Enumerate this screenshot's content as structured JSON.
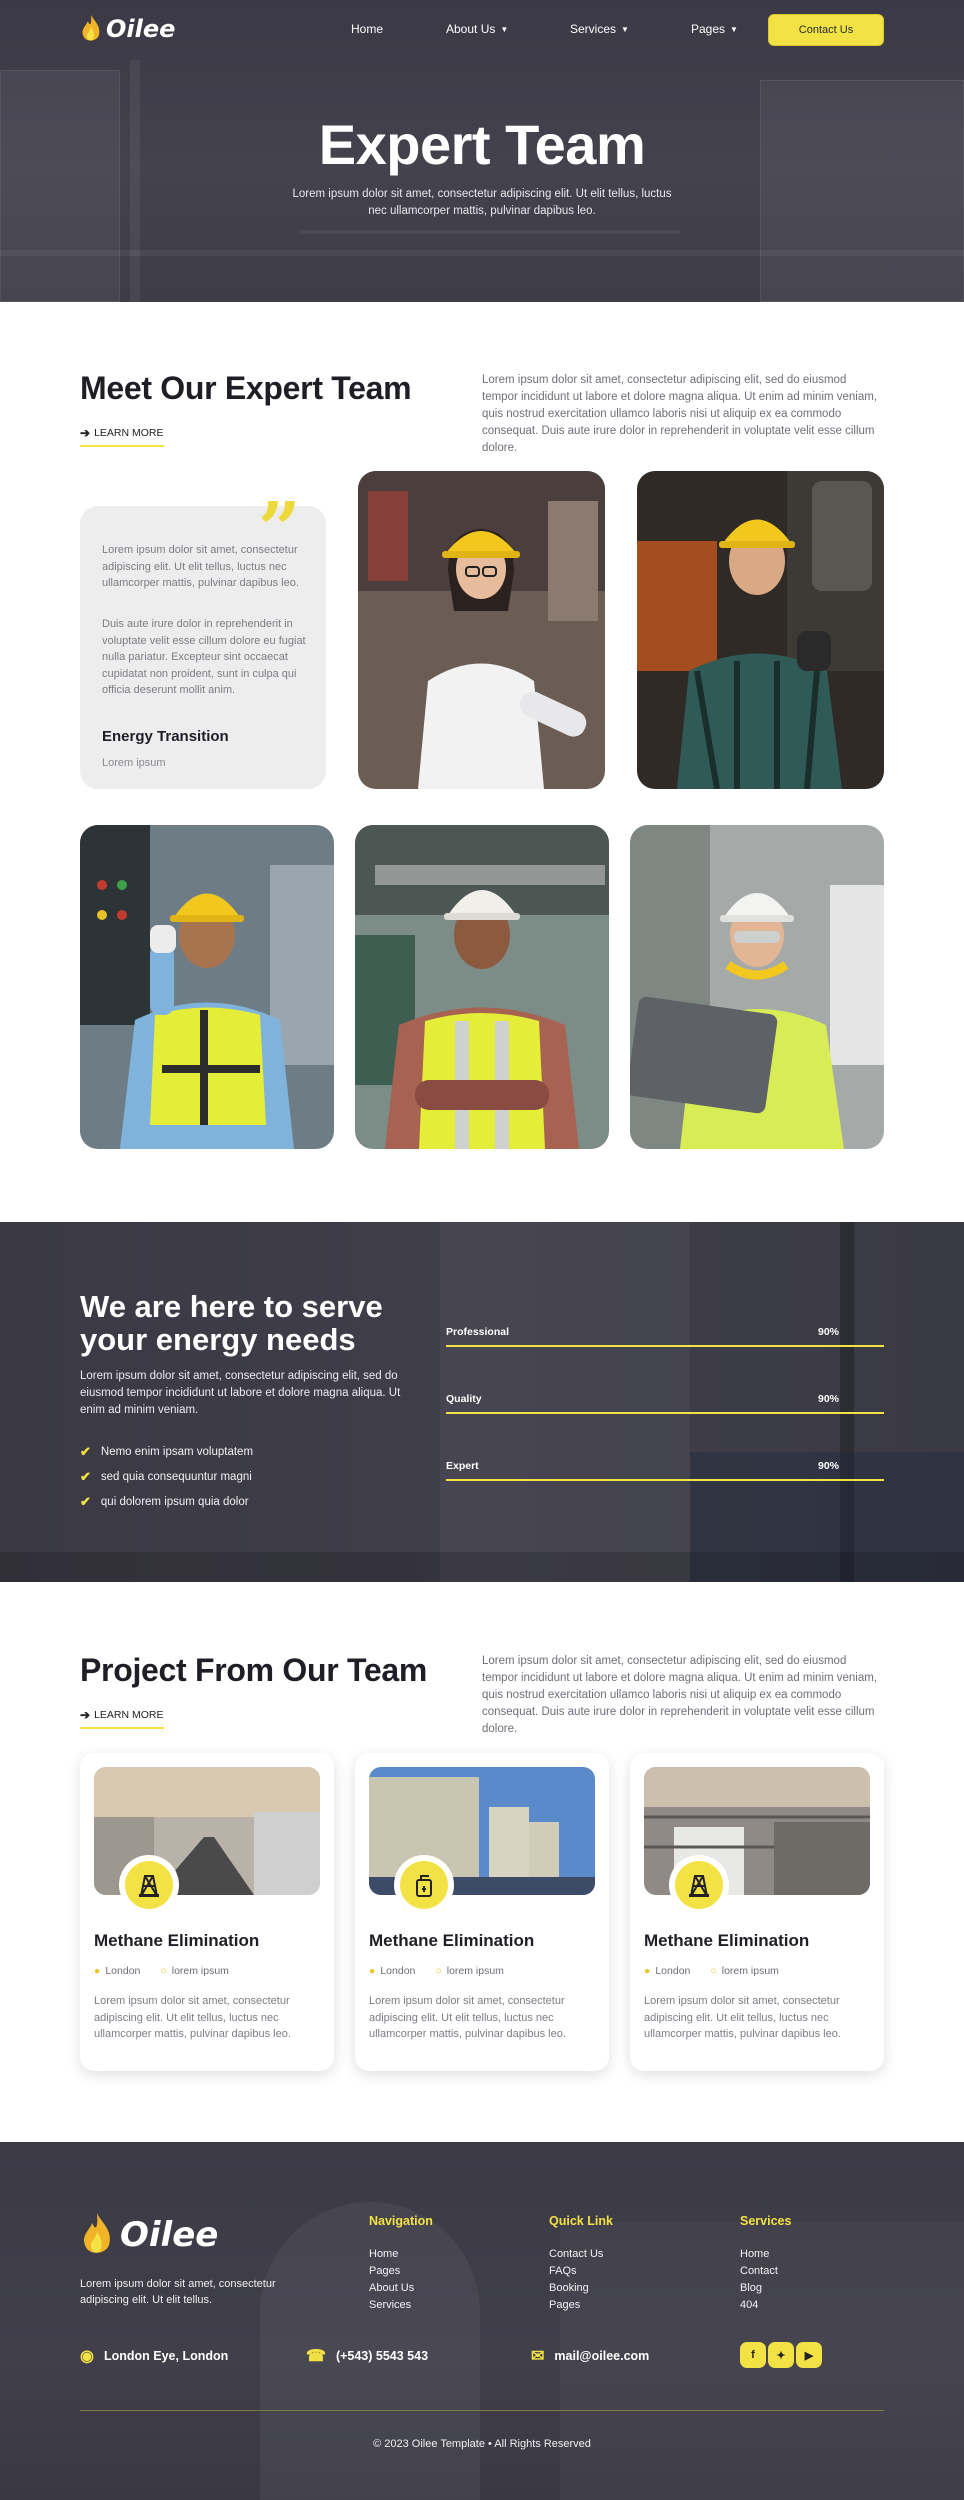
{
  "colors": {
    "accent": "#f3e244",
    "dark": "#3e3d48",
    "text_muted": "#6e6e78"
  },
  "nav": {
    "logo": "Oilee",
    "items": [
      {
        "label": "Home",
        "dropdown": false
      },
      {
        "label": "About Us",
        "dropdown": true
      },
      {
        "label": "Services",
        "dropdown": true
      },
      {
        "label": "Pages",
        "dropdown": true
      }
    ],
    "contact_label": "Contact Us"
  },
  "hero": {
    "title": "Expert Team",
    "subtitle": "Lorem ipsum dolor sit amet, consectetur adipiscing elit. Ut elit tellus, luctus nec ullamcorper mattis, pulvinar dapibus leo."
  },
  "team": {
    "title": "Meet Our Expert Team",
    "paragraph": "Lorem ipsum dolor sit amet, consectetur adipiscing elit, sed do eiusmod tempor incididunt ut labore et dolore magna aliqua. Ut enim ad minim veniam, quis nostrud exercitation ullamco laboris nisi ut aliquip ex ea commodo consequat. Duis aute irure dolor in reprehenderit in voluptate velit esse cillum dolore.",
    "learn_more": "LEARN MORE",
    "quote": {
      "p1": "Lorem ipsum dolor sit amet, consectetur adipiscing elit. Ut elit tellus, luctus nec ullamcorper mattis, pulvinar dapibus leo.",
      "p2": "Duis aute irure dolor in reprehenderit in voluptate velit esse cillum dolore eu fugiat nulla pariatur. Excepteur sint occaecat cupidatat non proident, sunt in culpa qui officia deserunt mollit anim.",
      "name": "Energy Transition",
      "role": "Lorem ipsum"
    }
  },
  "serve": {
    "title": "We are here to serve your energy needs",
    "paragraph": "Lorem ipsum dolor sit amet, consectetur adipiscing elit, sed do eiusmod tempor incididunt ut labore et dolore magna aliqua. Ut enim ad minim veniam.",
    "checklist": [
      "Nemo enim ipsam voluptatem",
      "sed quia consequuntur magni",
      "qui dolorem ipsum quia dolor"
    ],
    "skills": [
      {
        "label": "Professional",
        "value": "90%",
        "fraction": 0.9
      },
      {
        "label": "Quality",
        "value": "90%",
        "fraction": 0.9
      },
      {
        "label": "Expert",
        "value": "90%",
        "fraction": 0.9
      }
    ]
  },
  "projects": {
    "title": "Project From Our Team",
    "paragraph": "Lorem ipsum dolor sit amet, consectetur adipiscing elit, sed do eiusmod tempor incididunt ut labore et dolore magna aliqua. Ut enim ad minim veniam, quis nostrud exercitation ullamco laboris nisi ut aliquip ex ea commodo consequat. Duis aute irure dolor in reprehenderit in voluptate velit esse cillum dolore.",
    "learn_more": "LEARN MORE",
    "cards": [
      {
        "title": "Methane Elimination",
        "location": "London",
        "tag": "lorem ipsum",
        "icon": "oil-rig-icon",
        "desc": "Lorem ipsum dolor sit amet, consectetur adipiscing elit. Ut elit tellus, luctus nec ullamcorper mattis, pulvinar dapibus leo."
      },
      {
        "title": "Methane Elimination",
        "location": "London",
        "tag": "lorem ipsum",
        "icon": "fuel-can-icon",
        "desc": "Lorem ipsum dolor sit amet, consectetur adipiscing elit. Ut elit tellus, luctus nec ullamcorper mattis, pulvinar dapibus leo."
      },
      {
        "title": "Methane Elimination",
        "location": "London",
        "tag": "lorem ipsum",
        "icon": "oil-rig-icon",
        "desc": "Lorem ipsum dolor sit amet, consectetur adipiscing elit. Ut elit tellus, luctus nec ullamcorper mattis, pulvinar dapibus leo."
      }
    ]
  },
  "footer": {
    "logo": "Oilee",
    "about": "Lorem ipsum dolor sit amet, consectetur adipiscing elit. Ut elit tellus.",
    "navigation": {
      "heading": "Navigation",
      "links": [
        "Home",
        "Pages",
        "About Us",
        "Services"
      ]
    },
    "quick_link": {
      "heading": "Quick Link",
      "links": [
        "Contact Us",
        "FAQs",
        "Booking",
        "Pages"
      ]
    },
    "services": {
      "heading": "Services",
      "links": [
        "Home",
        "Contact",
        "Blog",
        "404"
      ]
    },
    "address": "London Eye, London",
    "phone": "(+543) 5543 543",
    "email": "mail@oilee.com",
    "social": [
      "facebook-icon",
      "twitter-icon",
      "youtube-icon"
    ],
    "copyright": "© 2023 Oilee Template • All Rights Reserved"
  }
}
